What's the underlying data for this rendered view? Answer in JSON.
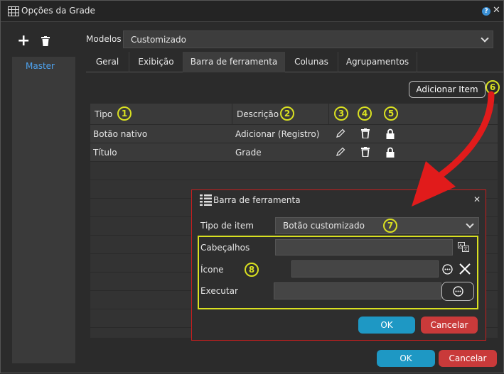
{
  "window": {
    "title": "Opções da Grade",
    "help_icon": "?",
    "close_icon": "✕"
  },
  "sidebar": {
    "items": [
      {
        "label": "Master"
      }
    ]
  },
  "modelos": {
    "label": "Modelos",
    "value": "Customizado"
  },
  "tabs": [
    {
      "label": "Geral"
    },
    {
      "label": "Exibição"
    },
    {
      "label": "Barra de ferramenta"
    },
    {
      "label": "Colunas"
    },
    {
      "label": "Agrupamentos"
    }
  ],
  "toolbar": {
    "add_item_label": "Adicionar Item"
  },
  "grid": {
    "columns": [
      {
        "label": "Tipo"
      },
      {
        "label": "Descrição"
      }
    ],
    "rows": [
      {
        "tipo": "Botão nativo",
        "descricao": "Adicionar (Registro)"
      },
      {
        "tipo": "Título",
        "descricao": "Grade"
      }
    ]
  },
  "badges": {
    "b1": "1",
    "b2": "2",
    "b3": "3",
    "b4": "4",
    "b5": "5",
    "b6": "6",
    "b7": "7",
    "b8": "8"
  },
  "dialog": {
    "title": "Barra de ferramenta",
    "close_icon": "✕",
    "tipo_item_label": "Tipo de item",
    "tipo_item_value": "Botão customizado",
    "cabecalhos_label": "Cabeçalhos",
    "icone_label": "Ícone",
    "executar_label": "Executar",
    "ok_label": "OK",
    "cancel_label": "Cancelar"
  },
  "footer": {
    "ok_label": "OK",
    "cancel_label": "Cancelar"
  },
  "colors": {
    "accent": "#1e98c4",
    "danger": "#c93a3a",
    "highlight": "#d9e021",
    "annotation": "#e11b1b"
  }
}
